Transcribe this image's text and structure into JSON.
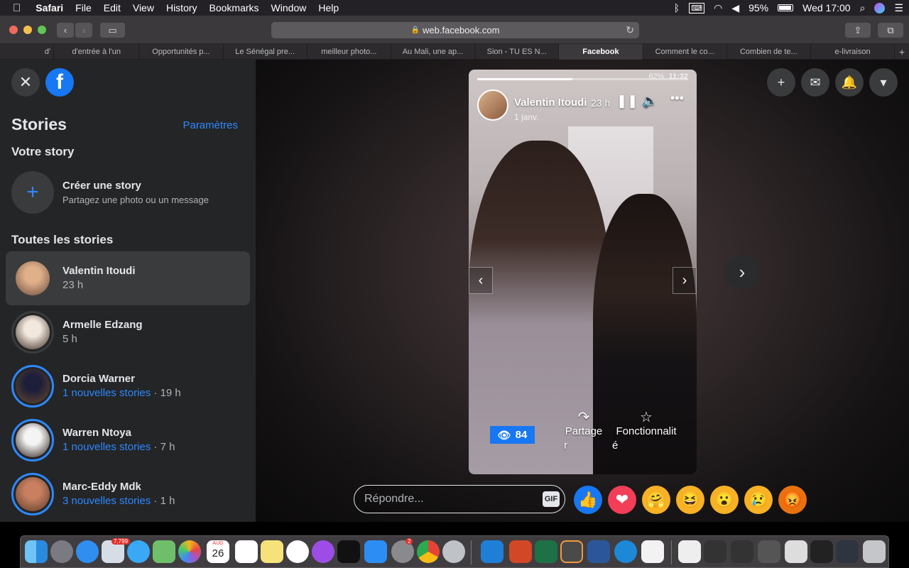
{
  "menubar": {
    "app": "Safari",
    "items": [
      "File",
      "Edit",
      "View",
      "History",
      "Bookmarks",
      "Window",
      "Help"
    ],
    "battery": "95%",
    "clock": "Wed 17:00"
  },
  "browser": {
    "url": "web.facebook.com",
    "tabs": [
      {
        "label": "d'"
      },
      {
        "label": "d'entrée à l'un"
      },
      {
        "label": "Opportunités p..."
      },
      {
        "label": "Le Sénégal pre..."
      },
      {
        "label": "meilleur photo..."
      },
      {
        "label": "Au Mali, une ap..."
      },
      {
        "label": "Sion - TU ES N..."
      },
      {
        "label": "Facebook",
        "active": true
      },
      {
        "label": "Comment le co..."
      },
      {
        "label": "Combien de te..."
      },
      {
        "label": "e-livraison"
      }
    ]
  },
  "sidebar": {
    "title": "Stories",
    "settings_link": "Paramètres",
    "your_story_heading": "Votre story",
    "create": {
      "title": "Créer une story",
      "subtitle": "Partagez une photo ou un message"
    },
    "all_heading": "Toutes les stories",
    "stories": [
      {
        "name": "Valentin Itoudi",
        "meta": "23 h",
        "new": "",
        "selected": true,
        "colors": [
          "#e0b08a",
          "#6a4a3a"
        ]
      },
      {
        "name": "Armelle Edzang",
        "meta": "5 h",
        "new": "",
        "selected": false,
        "colors": [
          "#f2e8de",
          "#3a2820"
        ]
      },
      {
        "name": "Dorcia Warner",
        "meta": " · 19 h",
        "new": "1 nouvelles stories",
        "selected": false,
        "colors": [
          "#1c1e3a",
          "#6a4a2a"
        ]
      },
      {
        "name": "Warren Ntoya",
        "meta": " · 7 h",
        "new": "1 nouvelles stories",
        "selected": false,
        "colors": [
          "#f4f4f4",
          "#2a1e18"
        ]
      },
      {
        "name": "Marc-Eddy Mdk",
        "meta": " · 1 h",
        "new": "3 nouvelles stories",
        "selected": false,
        "colors": [
          "#c88060",
          "#5a3a2a"
        ]
      }
    ]
  },
  "story": {
    "author": "Valentin Itoudi",
    "time": "23 h",
    "views": "84",
    "share_label_1": "Partage",
    "share_label_2": "r",
    "features_label_1": "Fonctionnalit",
    "features_label_2": "é",
    "overlay_status_battery": "62%",
    "overlay_status_clock": "11:32",
    "overlay_name": "Valentin Itoudi",
    "overlay_date": "1 janv.",
    "progress": 0.45
  },
  "reply": {
    "placeholder": "Répondre...",
    "gif_label": "GIF"
  },
  "reactions": [
    {
      "name": "like",
      "glyph": "👍",
      "bg": "#1877f2"
    },
    {
      "name": "love",
      "glyph": "❤",
      "bg": "#f33e58"
    },
    {
      "name": "care",
      "glyph": "🤗",
      "bg": "#f7b125"
    },
    {
      "name": "haha",
      "glyph": "😆",
      "bg": "#f7b125"
    },
    {
      "name": "wow",
      "glyph": "😮",
      "bg": "#f7b125"
    },
    {
      "name": "sad",
      "glyph": "😢",
      "bg": "#f7b125"
    },
    {
      "name": "angry",
      "glyph": "😡",
      "bg": "#e9710f"
    }
  ],
  "dock": {
    "mail_badge": "7,799",
    "prefs_badge": "2",
    "calendar_day": "26",
    "calendar_month": "AUG"
  }
}
